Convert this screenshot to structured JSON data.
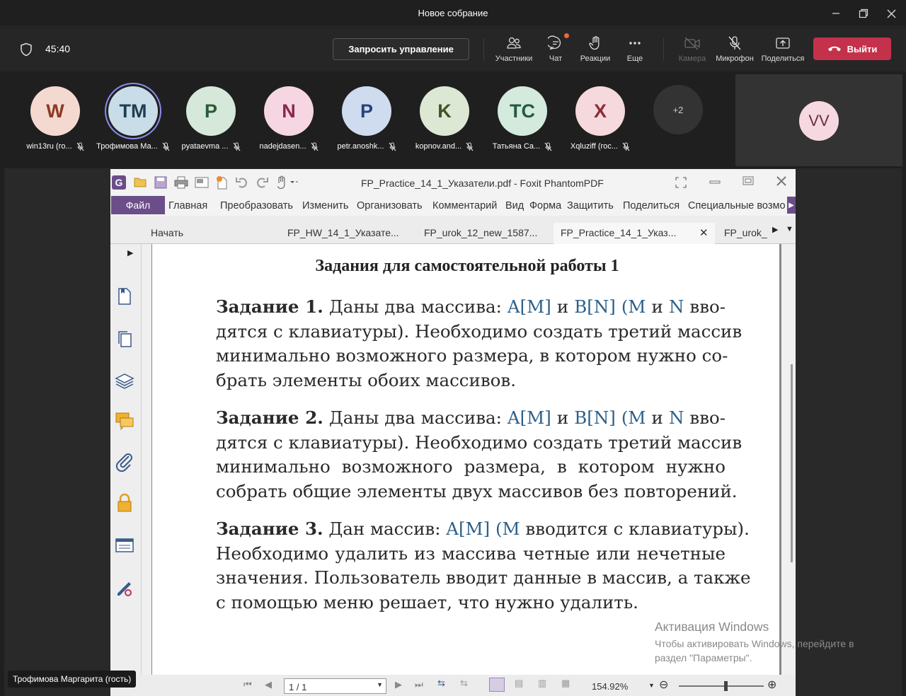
{
  "window": {
    "title": "Новое собрание"
  },
  "meeting": {
    "timer": "45:40",
    "request_control": "Запросить управление",
    "toolbar": {
      "participants": "Участники",
      "chat": "Чат",
      "reactions": "Реакции",
      "more": "Еще",
      "camera": "Камера",
      "mic": "Микрофон",
      "share": "Поделиться",
      "leave": "Выйти"
    }
  },
  "participants": [
    {
      "initials": "W",
      "name": "win13ru (го...",
      "bg": "#f4d9d0",
      "fg": "#8b3a23"
    },
    {
      "initials": "TM",
      "name": "Трофимова Ма...",
      "bg": "#c9dde8",
      "fg": "#1f3e52"
    },
    {
      "initials": "P",
      "name": "pyataevma ...",
      "bg": "#d5e8da",
      "fg": "#2c5a36"
    },
    {
      "initials": "N",
      "name": "nadejdasen...",
      "bg": "#f6d6e2",
      "fg": "#8a2650"
    },
    {
      "initials": "P",
      "name": "petr.anoshk...",
      "bg": "#cfdcef",
      "fg": "#26437a"
    },
    {
      "initials": "K",
      "name": "kopnov.and...",
      "bg": "#dde8d4",
      "fg": "#3f5526"
    },
    {
      "initials": "TC",
      "name": "Татьяна Са...",
      "bg": "#d3eadd",
      "fg": "#235a3d"
    },
    {
      "initials": "X",
      "name": "Xqluziff (гос...",
      "bg": "#f6d9dc",
      "fg": "#8c2d36"
    }
  ],
  "more_participants": "+2",
  "self_tile": {
    "initials": "VV"
  },
  "foxit": {
    "title": "FP_Practice_14_1_Указатели.pdf - Foxit PhantomPDF",
    "menu": {
      "file": "Файл",
      "items": [
        "Главная",
        "Преобразовать",
        "Изменить",
        "Организовать",
        "Комментарий",
        "Вид",
        "Форма",
        "Защитить",
        "Поделиться",
        "Специальные возмо"
      ]
    },
    "tabs": [
      "Начать",
      "FP_HW_14_1_Указате...",
      "FP_urok_12_new_1587...",
      "FP_Practice_14_1_Указ...",
      "FP_urok_"
    ],
    "status": {
      "page": "1 / 1",
      "zoom": "154.92%"
    }
  },
  "document": {
    "heading": "Задания для самостоятельной работы 1",
    "tasks": [
      {
        "label": "Задание 1.",
        "lines": [
          "Даны два массива: A[M] и B[N] (M и N вво-",
          "дятся с клавиатуры). Необходимо создать третий массив",
          "минимально возможного размера, в котором нужно со-",
          "брать элементы обоих массивов."
        ]
      },
      {
        "label": "Задание 2.",
        "lines": [
          "Даны два массива: A[M] и B[N] (M и N вво-",
          "дятся с клавиатуры). Необходимо создать третий массив",
          "минимально возможного размера, в котором нужно",
          "собрать общие элементы двух массивов без повторений."
        ]
      },
      {
        "label": "Задание 3.",
        "lines": [
          "Дан массив: A[M] (M вводится с клавиатуры).",
          "Необходимо удалить из массива четные или нечетные",
          "значения. Пользователь вводит данные в массив, а также",
          "с помощью меню решает, что нужно удалить."
        ]
      }
    ]
  },
  "watermark": {
    "line1": "Активация Windows",
    "line2": "Чтобы активировать Windows, перейдите в раздел \"Параметры\"."
  },
  "presenter_label": "Трофимова Маргарита (гость)"
}
